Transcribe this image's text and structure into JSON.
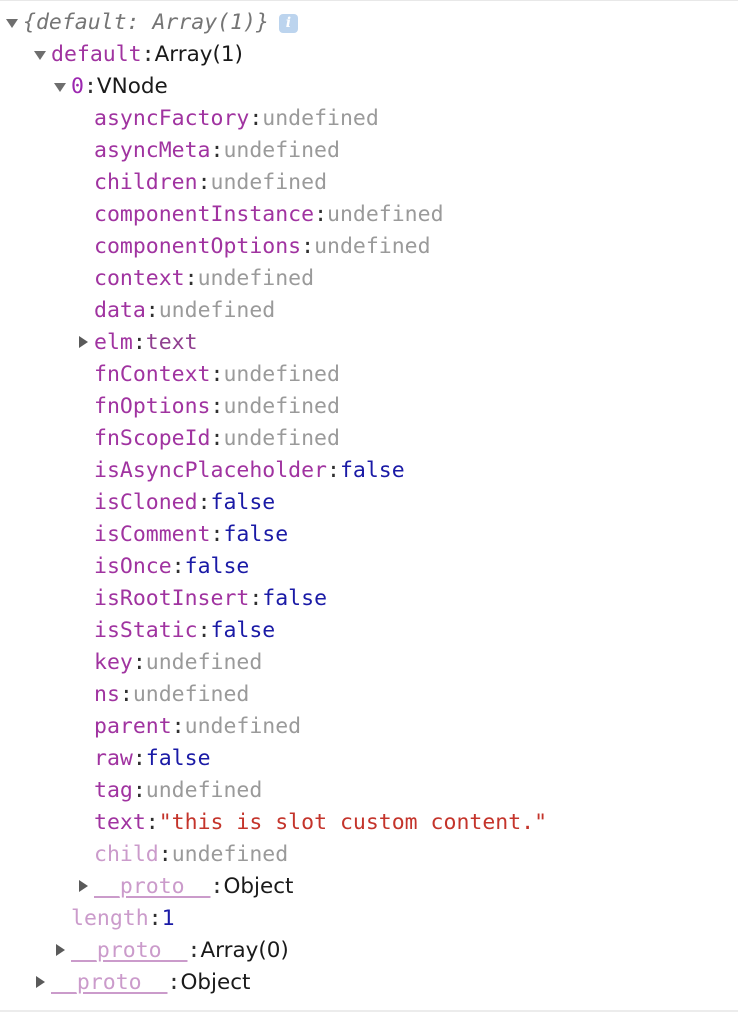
{
  "panel": {
    "kind": "devtools-console-object-inspector",
    "background_color": "#ffffff",
    "border_color": "#e8e8e8"
  },
  "colors": {
    "key": "#a033a0",
    "key_dim": "#cb9bcb",
    "undefined": "#9a9a9a",
    "boolean": "#1a1aa6",
    "number": "#1a1aa6",
    "string": "#c4342b",
    "node": "#8f3f8f",
    "object": "#1a1a1a",
    "root_preview": "#757575",
    "info_badge": "#bcd4ee"
  },
  "root": {
    "preview": "{default: Array(1)}",
    "info_icon": "info-icon",
    "expanded": true
  },
  "rows": [
    {
      "indent": 1,
      "arrow": "open",
      "key": "default",
      "key_style": "key",
      "sep": ": ",
      "value": "Array(1)",
      "value_style": "val-array"
    },
    {
      "indent": 2,
      "arrow": "open",
      "key": "0",
      "key_style": "key-strong",
      "sep": ": ",
      "value": "VNode",
      "value_style": "val-object"
    },
    {
      "indent": 3,
      "arrow": "none",
      "key": "asyncFactory",
      "key_style": "key",
      "sep": ": ",
      "value": "undefined",
      "value_style": "val-undefined"
    },
    {
      "indent": 3,
      "arrow": "none",
      "key": "asyncMeta",
      "key_style": "key",
      "sep": ": ",
      "value": "undefined",
      "value_style": "val-undefined"
    },
    {
      "indent": 3,
      "arrow": "none",
      "key": "children",
      "key_style": "key",
      "sep": ": ",
      "value": "undefined",
      "value_style": "val-undefined"
    },
    {
      "indent": 3,
      "arrow": "none",
      "key": "componentInstance",
      "key_style": "key",
      "sep": ": ",
      "value": "undefined",
      "value_style": "val-undefined"
    },
    {
      "indent": 3,
      "arrow": "none",
      "key": "componentOptions",
      "key_style": "key",
      "sep": ": ",
      "value": "undefined",
      "value_style": "val-undefined"
    },
    {
      "indent": 3,
      "arrow": "none",
      "key": "context",
      "key_style": "key",
      "sep": ": ",
      "value": "undefined",
      "value_style": "val-undefined"
    },
    {
      "indent": 3,
      "arrow": "none",
      "key": "data",
      "key_style": "key",
      "sep": ": ",
      "value": "undefined",
      "value_style": "val-undefined"
    },
    {
      "indent": 3,
      "arrow": "closed",
      "key": "elm",
      "key_style": "key",
      "sep": ": ",
      "value": "text",
      "value_style": "val-node"
    },
    {
      "indent": 3,
      "arrow": "none",
      "key": "fnContext",
      "key_style": "key",
      "sep": ": ",
      "value": "undefined",
      "value_style": "val-undefined"
    },
    {
      "indent": 3,
      "arrow": "none",
      "key": "fnOptions",
      "key_style": "key",
      "sep": ": ",
      "value": "undefined",
      "value_style": "val-undefined"
    },
    {
      "indent": 3,
      "arrow": "none",
      "key": "fnScopeId",
      "key_style": "key",
      "sep": ": ",
      "value": "undefined",
      "value_style": "val-undefined"
    },
    {
      "indent": 3,
      "arrow": "none",
      "key": "isAsyncPlaceholder",
      "key_style": "key",
      "sep": ": ",
      "value": "false",
      "value_style": "val-boolean"
    },
    {
      "indent": 3,
      "arrow": "none",
      "key": "isCloned",
      "key_style": "key",
      "sep": ": ",
      "value": "false",
      "value_style": "val-boolean"
    },
    {
      "indent": 3,
      "arrow": "none",
      "key": "isComment",
      "key_style": "key",
      "sep": ": ",
      "value": "false",
      "value_style": "val-boolean"
    },
    {
      "indent": 3,
      "arrow": "none",
      "key": "isOnce",
      "key_style": "key",
      "sep": ": ",
      "value": "false",
      "value_style": "val-boolean"
    },
    {
      "indent": 3,
      "arrow": "none",
      "key": "isRootInsert",
      "key_style": "key",
      "sep": ": ",
      "value": "false",
      "value_style": "val-boolean"
    },
    {
      "indent": 3,
      "arrow": "none",
      "key": "isStatic",
      "key_style": "key",
      "sep": ": ",
      "value": "false",
      "value_style": "val-boolean"
    },
    {
      "indent": 3,
      "arrow": "none",
      "key": "key",
      "key_style": "key",
      "sep": ": ",
      "value": "undefined",
      "value_style": "val-undefined"
    },
    {
      "indent": 3,
      "arrow": "none",
      "key": "ns",
      "key_style": "key",
      "sep": ": ",
      "value": "undefined",
      "value_style": "val-undefined"
    },
    {
      "indent": 3,
      "arrow": "none",
      "key": "parent",
      "key_style": "key",
      "sep": ": ",
      "value": "undefined",
      "value_style": "val-undefined"
    },
    {
      "indent": 3,
      "arrow": "none",
      "key": "raw",
      "key_style": "key",
      "sep": ": ",
      "value": "false",
      "value_style": "val-boolean"
    },
    {
      "indent": 3,
      "arrow": "none",
      "key": "tag",
      "key_style": "key",
      "sep": ": ",
      "value": "undefined",
      "value_style": "val-undefined"
    },
    {
      "indent": 3,
      "arrow": "none",
      "key": "text",
      "key_style": "key",
      "sep": ": ",
      "value": "\"this is slot custom content.\"",
      "value_style": "val-string"
    },
    {
      "indent": 3,
      "arrow": "none",
      "key": "child",
      "key_style": "key-dim",
      "sep": ": ",
      "value": "undefined",
      "value_style": "val-undefined"
    },
    {
      "indent": 3,
      "arrow": "closed",
      "key": "__proto__",
      "key_style": "key-proto",
      "sep": ": ",
      "value": "Object",
      "value_style": "val-object"
    },
    {
      "indent": 2,
      "arrow": "none",
      "key": "length",
      "key_style": "key-dim",
      "sep": ": ",
      "value": "1",
      "value_style": "val-number"
    },
    {
      "indent": 2,
      "arrow": "closed",
      "key": "__proto__",
      "key_style": "key-proto",
      "sep": ": ",
      "value": "Array(0)",
      "value_style": "val-array"
    },
    {
      "indent": 1,
      "arrow": "closed",
      "key": "__proto__",
      "key_style": "key-proto",
      "sep": ": ",
      "value": "Object",
      "value_style": "val-object"
    }
  ]
}
